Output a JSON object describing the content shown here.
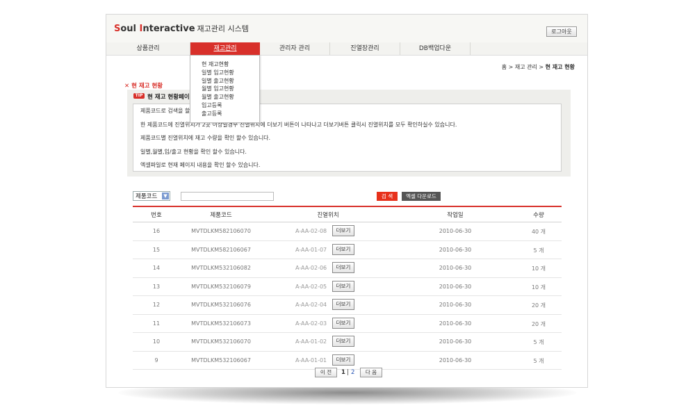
{
  "header": {
    "logo_s": "S",
    "logo_oul": "oul ",
    "logo_i": "I",
    "logo_nteractive": "nteractive",
    "logo_sub": "재고관리 시스템",
    "logout_label": "로그아웃"
  },
  "nav": {
    "items": [
      {
        "label": "상품관리"
      },
      {
        "label": "재고관리"
      },
      {
        "label": "관리자 관리"
      },
      {
        "label": "진열장관리"
      },
      {
        "label": "DB백업다운"
      }
    ],
    "dropdown": [
      "현 재고현황",
      "일별 입고현황",
      "일별 출고현황",
      "월별 입고현황",
      "월별 출고현황",
      "입고등록",
      "출고등록"
    ]
  },
  "breadcrumb": {
    "path": "홈 > 재고 관리 > ",
    "current": "현 재고 현황"
  },
  "section": {
    "title": "✕ 현 재고 현황",
    "tip_badge": "TIP",
    "tip_title": "현 재고 현황페이",
    "tip_lines": [
      "제품코드로 검색을 할",
      "한 제품코드에 진열위치가 2곳 이상일경우 진열위치에 더보기 버튼이 나타나고 더보기버튼 클릭시 진열위치를 모두 확인하실수 있습니다.",
      "제품코드별 진열위치에 재고 수량을 확인 할수 있습니다.",
      "일별,월별,입/출고 현황을 확인 할수 있습니다.",
      "엑셀파일로 현재 페이지 내용을 확인 할수 있습니다."
    ]
  },
  "search": {
    "select_value": "제품코드",
    "input_value": "",
    "search_label": "검 색",
    "excel_label": "엑셀 다운로드"
  },
  "table": {
    "headers": [
      "번호",
      "제품코드",
      "진열위치",
      "작업일",
      "수량"
    ],
    "more_label": "더보기",
    "rows": [
      {
        "num": "16",
        "code": "MVTDLKM582106070",
        "loc": "A-AA-02-08",
        "date": "2010-06-30",
        "qty": "40 개"
      },
      {
        "num": "15",
        "code": "MVTDLKM582106067",
        "loc": "A-AA-01-07",
        "date": "2010-06-30",
        "qty": "5 개"
      },
      {
        "num": "14",
        "code": "MVTDLKM532106082",
        "loc": "A-AA-02-06",
        "date": "2010-06-30",
        "qty": "10 개"
      },
      {
        "num": "13",
        "code": "MVTDLKM532106079",
        "loc": "A-AA-02-05",
        "date": "2010-06-30",
        "qty": "10 개"
      },
      {
        "num": "12",
        "code": "MVTDLKM532106076",
        "loc": "A-AA-02-04",
        "date": "2010-06-30",
        "qty": "20 개"
      },
      {
        "num": "11",
        "code": "MVTDLKM532106073",
        "loc": "A-AA-02-03",
        "date": "2010-06-30",
        "qty": "20 개"
      },
      {
        "num": "10",
        "code": "MVTDLKM532106070",
        "loc": "A-AA-01-02",
        "date": "2010-06-30",
        "qty": "5 개"
      },
      {
        "num": "9",
        "code": "MVTDLKM532106067",
        "loc": "A-AA-01-01",
        "date": "2010-06-30",
        "qty": "5 개"
      }
    ]
  },
  "pager": {
    "prev": "이 전",
    "page1": "1",
    "sep": "|",
    "page2": "2",
    "next": "다 음"
  }
}
